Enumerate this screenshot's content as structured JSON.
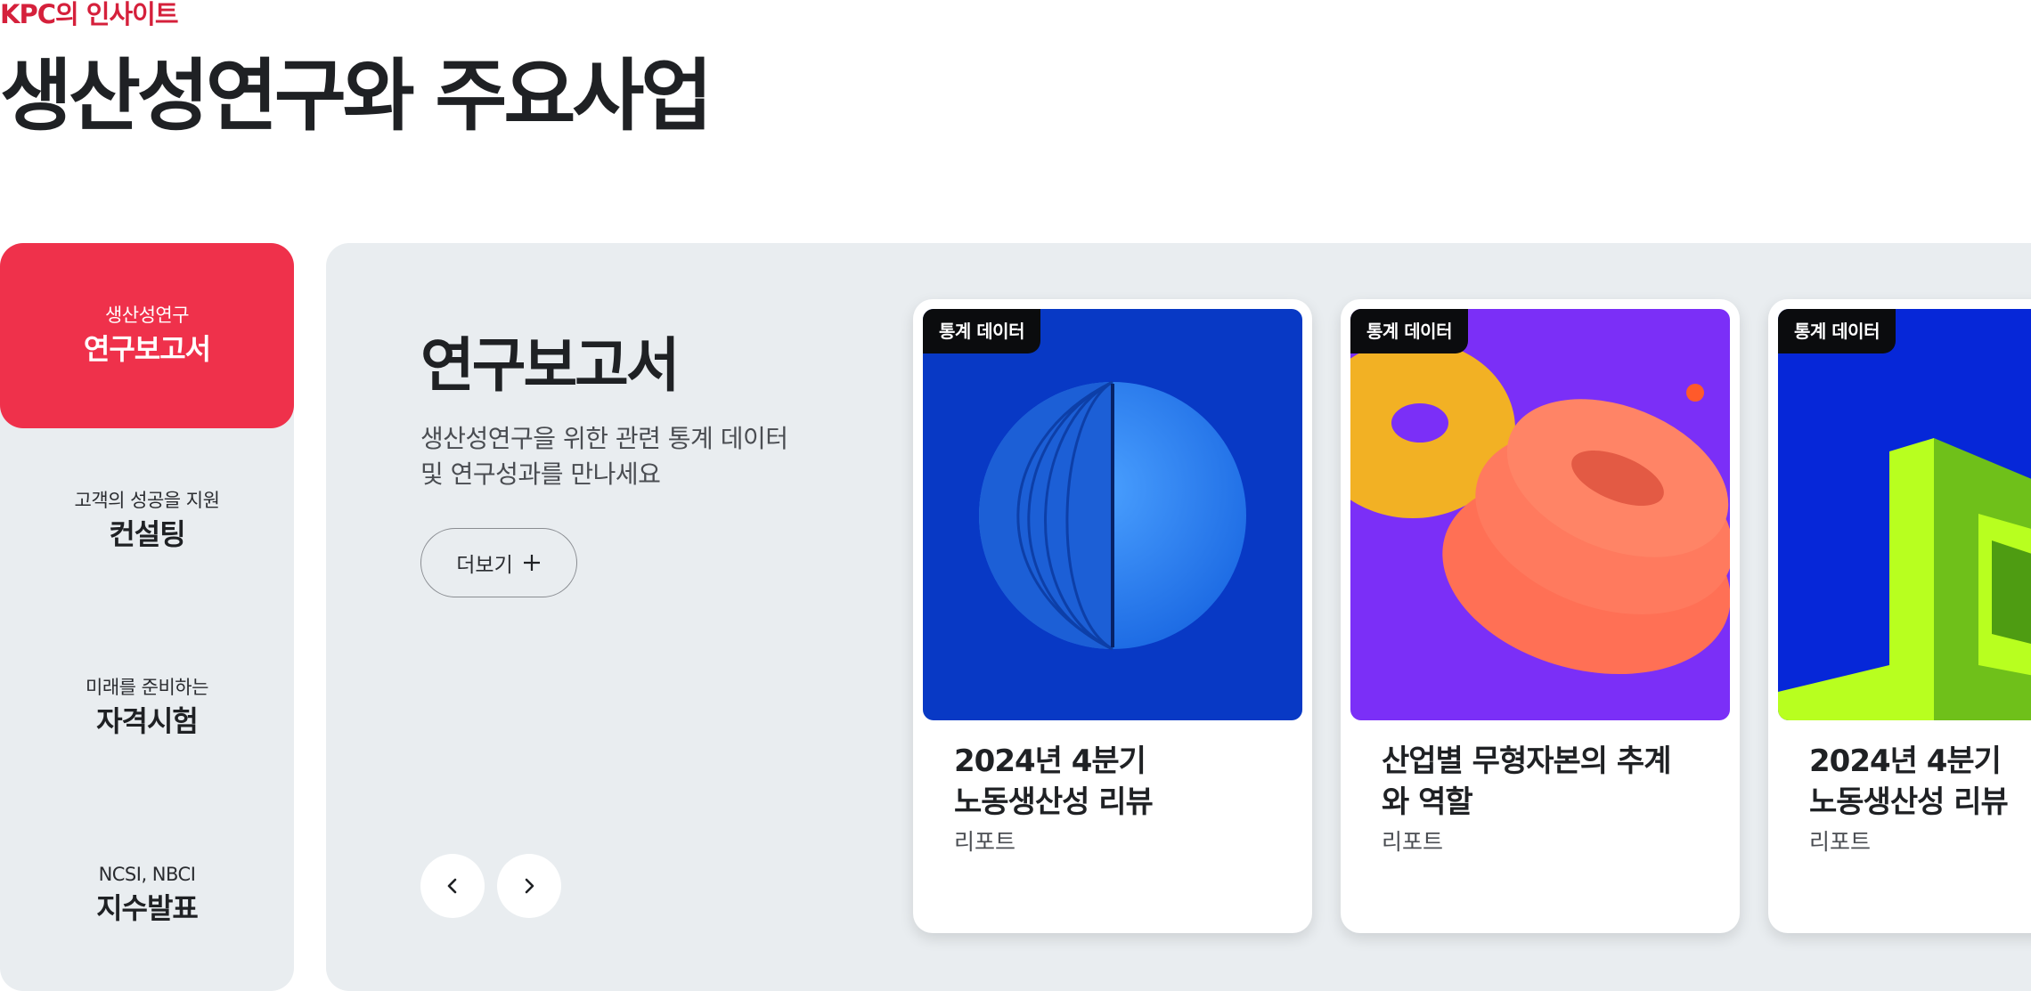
{
  "header": {
    "eyebrow": "KPC의 인사이트",
    "title": "생산성연구와 주요사업"
  },
  "side_menu": {
    "items": [
      {
        "sub": "생산성연구",
        "main": "연구보고서",
        "active": true
      },
      {
        "sub": "고객의 성공을 지원",
        "main": "컨설팅",
        "active": false
      },
      {
        "sub": "미래를 준비하는",
        "main": "자격시험",
        "active": false
      },
      {
        "sub": "NCSI, NBCI",
        "main": "지수발표",
        "active": false
      }
    ]
  },
  "panel": {
    "title": "연구보고서",
    "desc_line1": "생산성연구을 위한 관련 통계 데이터",
    "desc_line2": "및 연구성과를 만나세요",
    "more_label": "더보기",
    "more_icon": "plus-icon",
    "prev_icon": "chevron-left-icon",
    "next_icon": "chevron-right-icon"
  },
  "cards": [
    {
      "badge": "통계 데이터",
      "title_line1": "2024년 4분기",
      "title_line2": "노동생산성 리뷰",
      "category": "리포트",
      "bg": "#0839c5"
    },
    {
      "badge": "통계 데이터",
      "title_line1": "산업별 무형자본의 추계",
      "title_line2": "와 역할",
      "category": "리포트",
      "bg": "#7b2ff7"
    },
    {
      "badge": "통계 데이터",
      "title_line1": "2024년 4분기",
      "title_line2": "노동생산성 리뷰",
      "category": "리포트",
      "bg": "#0627d8"
    }
  ],
  "colors": {
    "accent": "#ef314b",
    "eyebrow": "#d5203b",
    "panel_bg": "#e9edf0"
  }
}
